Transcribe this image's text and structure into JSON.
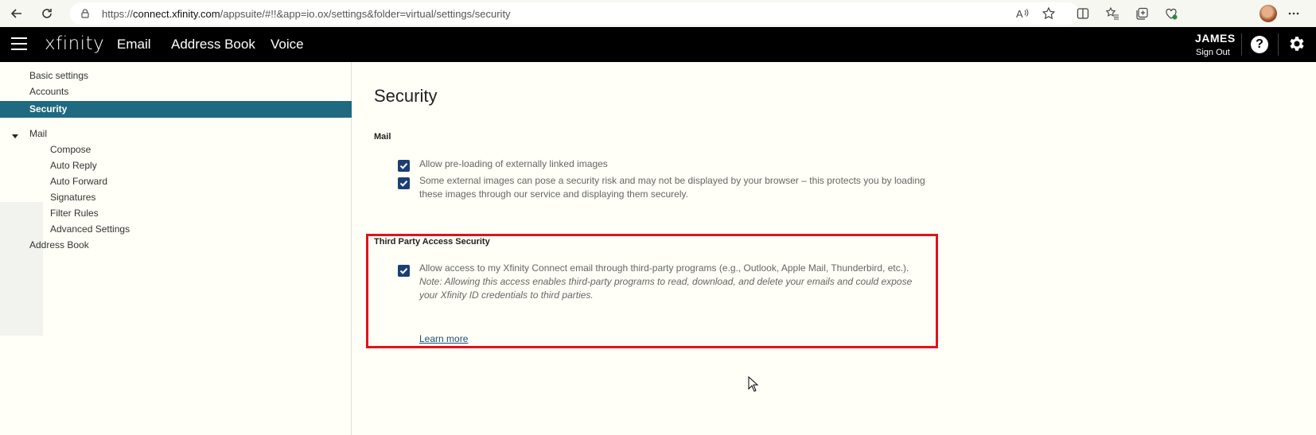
{
  "browser": {
    "url_prefix": "https://",
    "url_host": "connect.xfinity.com",
    "url_path": "/appsuite/#!!&app=io.ox/settings&folder=virtual/settings/security"
  },
  "header": {
    "logo": "xfinity",
    "tabs": [
      {
        "label": "Email"
      },
      {
        "label": "Address Book"
      },
      {
        "label": "Voice"
      }
    ],
    "user_name": "JAMES",
    "sign_out": "Sign Out",
    "help": "?"
  },
  "sidebar": {
    "items": [
      {
        "label": "Basic settings"
      },
      {
        "label": "Accounts"
      },
      {
        "label": "Security"
      }
    ],
    "mail_group": {
      "label": "Mail",
      "children": [
        {
          "label": "Compose"
        },
        {
          "label": "Auto Reply"
        },
        {
          "label": "Auto Forward"
        },
        {
          "label": "Signatures"
        },
        {
          "label": "Filter Rules"
        },
        {
          "label": "Advanced Settings"
        }
      ]
    },
    "address_book": "Address Book"
  },
  "main": {
    "title": "Security",
    "mail_section": {
      "title": "Mail",
      "options": [
        {
          "label": "Allow pre-loading of externally linked images",
          "checked": true
        },
        {
          "label_line1": "Some external images can pose a security risk and may not be displayed by your browser – this protects you by loading",
          "label_line2": "these images through our service and displaying them securely.",
          "checked": true
        }
      ]
    },
    "third_party_section": {
      "title": "Third Party Access Security",
      "option_label": "Allow access to my Xfinity Connect email through third-party programs (e.g., Outlook, Apple Mail, Thunderbird, etc.).",
      "note_line1": "Note: Allowing this access enables third-party programs to read, download, and delete your emails and could expose",
      "note_line2": "your Xfinity ID credentials to third parties.",
      "checked": true,
      "learn_more": "Learn more"
    }
  },
  "colors": {
    "header_bg": "#000000",
    "selected_bg": "#1f6a80",
    "checkbox": "#1c3f73",
    "highlight": "#e0121b"
  }
}
